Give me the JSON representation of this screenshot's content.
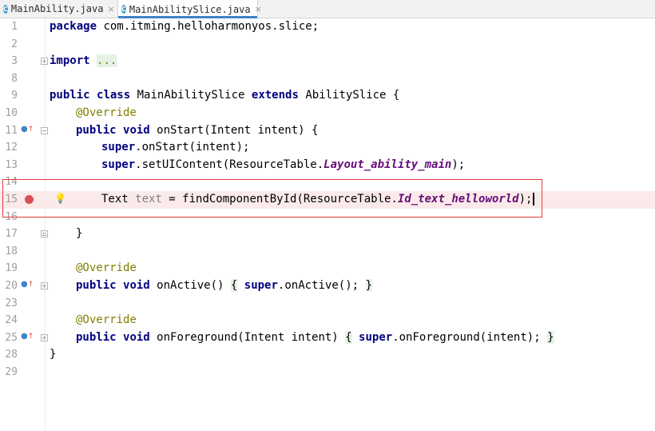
{
  "tabs": [
    {
      "icon": "C",
      "label": "MainAbility.java",
      "close": "×"
    },
    {
      "icon": "C",
      "label": "MainAbilitySlice.java",
      "close": "×"
    }
  ],
  "lines": {
    "l1": {
      "n": "1",
      "t": [
        "package",
        " com.itming.helloharmonyos.slice;"
      ]
    },
    "l2": {
      "n": "2"
    },
    "l3": {
      "n": "3",
      "t": [
        "import",
        " ",
        "..."
      ]
    },
    "l8": {
      "n": "8"
    },
    "l9": {
      "n": "9",
      "t": [
        "public",
        " ",
        "class",
        " MainAbilitySlice ",
        "extends",
        " AbilitySlice {"
      ]
    },
    "l10": {
      "n": "10",
      "t": [
        "@Override"
      ]
    },
    "l11": {
      "n": "11",
      "t": [
        "public",
        " ",
        "void",
        " onStart(Intent intent) {"
      ]
    },
    "l12": {
      "n": "12",
      "t": [
        "super",
        ".onStart(intent);"
      ]
    },
    "l13": {
      "n": "13",
      "t": [
        "super",
        ".setUIContent(ResourceTable.",
        "Layout_ability_main",
        ");"
      ]
    },
    "l14": {
      "n": "14"
    },
    "l15": {
      "n": "15",
      "t": [
        "Text ",
        "text",
        " = findComponentById(ResourceTable.",
        "Id_text_helloworld",
        ");"
      ]
    },
    "l16": {
      "n": "16"
    },
    "l17": {
      "n": "17",
      "t": [
        "}"
      ]
    },
    "l18": {
      "n": "18"
    },
    "l19": {
      "n": "19",
      "t": [
        "@Override"
      ]
    },
    "l20": {
      "n": "20",
      "t": [
        "public",
        " ",
        "void",
        " onActive() ",
        "{",
        " ",
        "super",
        ".onActive(); ",
        "}"
      ]
    },
    "l23": {
      "n": "23"
    },
    "l24": {
      "n": "24",
      "t": [
        "@Override"
      ]
    },
    "l25": {
      "n": "25",
      "t": [
        "public",
        " ",
        "void",
        " onForeground(Intent intent) ",
        "{",
        " ",
        "super",
        ".onForeground(intent); ",
        "}"
      ]
    },
    "l28": {
      "n": "28",
      "t": [
        "}"
      ]
    },
    "l29": {
      "n": "29"
    }
  },
  "colors": {
    "keyword": "#000080",
    "annotation": "#808000",
    "field": "#660e7a",
    "breakpoint": "#d84f4f",
    "highlight_box": "#e5393b"
  }
}
